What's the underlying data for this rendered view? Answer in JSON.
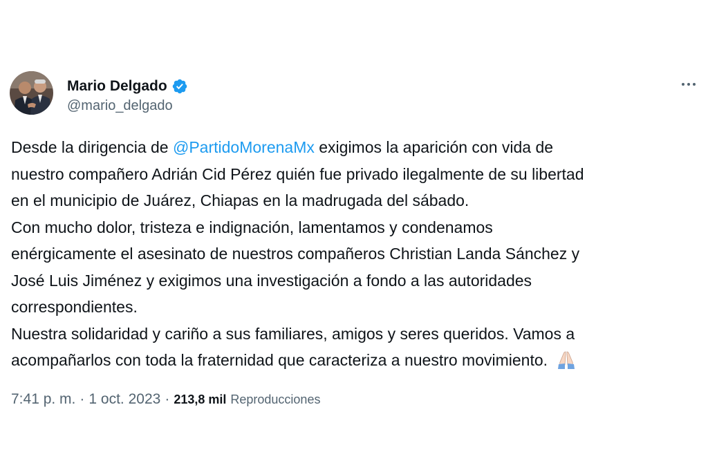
{
  "tweet": {
    "author": {
      "display_name": "Mario Delgado",
      "handle": "@mario_delgado",
      "verified": true
    },
    "body": {
      "line1_pre": "Desde la dirigencia de ",
      "line1_mention": "@PartidoMorenaMx",
      "line1_post": " exigimos la aparición con vida de",
      "line2": "nuestro compañero Adrián Cid Pérez quién fue privado ilegalmente de su libertad",
      "line3": "en el municipio de Juárez, Chiapas en la madrugada del sábado.",
      "line4": "Con mucho dolor, tristeza  e indignación, lamentamos y condenamos",
      "line5": "enérgicamente el asesinato de nuestros compañeros Christian Landa Sánchez y",
      "line6": "José Luis Jiménez y exigimos una investigación a fondo a las autoridades",
      "line7": "correspondientes.",
      "line8": "Nuestra solidaridad y cariño a sus familiares, amigos y seres queridos. Vamos a",
      "line9": "acompañarlos con toda la fraternidad que caracteriza a nuestro movimiento.",
      "emoji_icon": "folded-hands-emoji"
    },
    "meta": {
      "time": "7:41 p. m.",
      "separator": "·",
      "date": "1 oct. 2023",
      "views_count": "213,8 mil",
      "views_label": "Reproducciones"
    },
    "colors": {
      "link": "#1d9bf0",
      "text": "#0f1419",
      "secondary": "#536471",
      "verified_badge": "#1d9bf0"
    },
    "icons": {
      "more": "more-horizontal-icon",
      "verified": "verified-badge-icon"
    }
  }
}
